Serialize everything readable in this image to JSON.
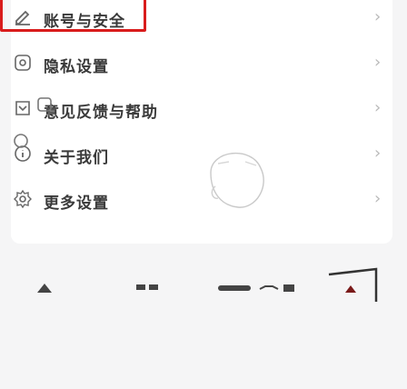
{
  "menu": [
    {
      "label": "账号与安全",
      "icon": "edit-icon"
    },
    {
      "label": "隐私设置",
      "icon": "privacy-icon"
    },
    {
      "label": "意见反馈与帮助",
      "icon": "feedback-icon"
    },
    {
      "label": "关于我们",
      "icon": "info-icon"
    },
    {
      "label": "更多设置",
      "icon": "settings-icon"
    }
  ],
  "colors": {
    "highlight": "#d91c1c",
    "icon": "#6e6e6e",
    "chevron": "#b9b9b9"
  }
}
